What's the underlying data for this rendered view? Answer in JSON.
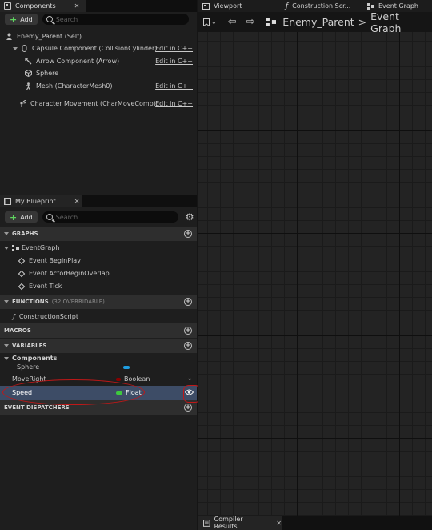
{
  "components_panel": {
    "tab_label": "Components",
    "add_label": "Add",
    "search_placeholder": "Search",
    "root": "Enemy_Parent (Self)",
    "items": [
      {
        "label": "Capsule Component (CollisionCylinder)",
        "edit": "Edit in C++"
      },
      {
        "label": "Arrow Component (Arrow)",
        "edit": "Edit in C++"
      },
      {
        "label": "Sphere",
        "edit": ""
      },
      {
        "label": "Mesh (CharacterMesh0)",
        "edit": "Edit in C++"
      },
      {
        "label": "Character Movement (CharMoveComp)",
        "edit": "Edit in C++"
      }
    ]
  },
  "blueprint_panel": {
    "tab_label": "My Blueprint",
    "add_label": "Add",
    "search_placeholder": "Search",
    "graphs_header": "GRAPHS",
    "event_graph": "EventGraph",
    "events": [
      "Event BeginPlay",
      "Event ActorBeginOverlap",
      "Event Tick"
    ],
    "functions_header": "FUNCTIONS",
    "functions_sub": "(32 OVERRIDABLE)",
    "construction_script": "ConstructionScript",
    "macros_header": "MACROS",
    "variables_header": "VARIABLES",
    "components_group": "Components",
    "variables": [
      {
        "name": "Sphere",
        "type": "",
        "pill_color": "#1f9de0"
      },
      {
        "name": "MoveRight",
        "type": "Boolean",
        "pill_color": "#8a0000"
      },
      {
        "name": "Speed",
        "type": "Float",
        "pill_color": "#3ec93e"
      }
    ],
    "dispatchers_header": "EVENT DISPATCHERS"
  },
  "editor": {
    "tabs": [
      "Viewport",
      "Construction Scr...",
      "Event Graph"
    ],
    "breadcrumb_root": "Enemy_Parent",
    "breadcrumb_sep": ">",
    "breadcrumb_current": "Event Graph",
    "bottom_tab": "Compiler Results"
  },
  "colors": {
    "annotation": "#c01818",
    "selected_row": "#3d4c66"
  }
}
